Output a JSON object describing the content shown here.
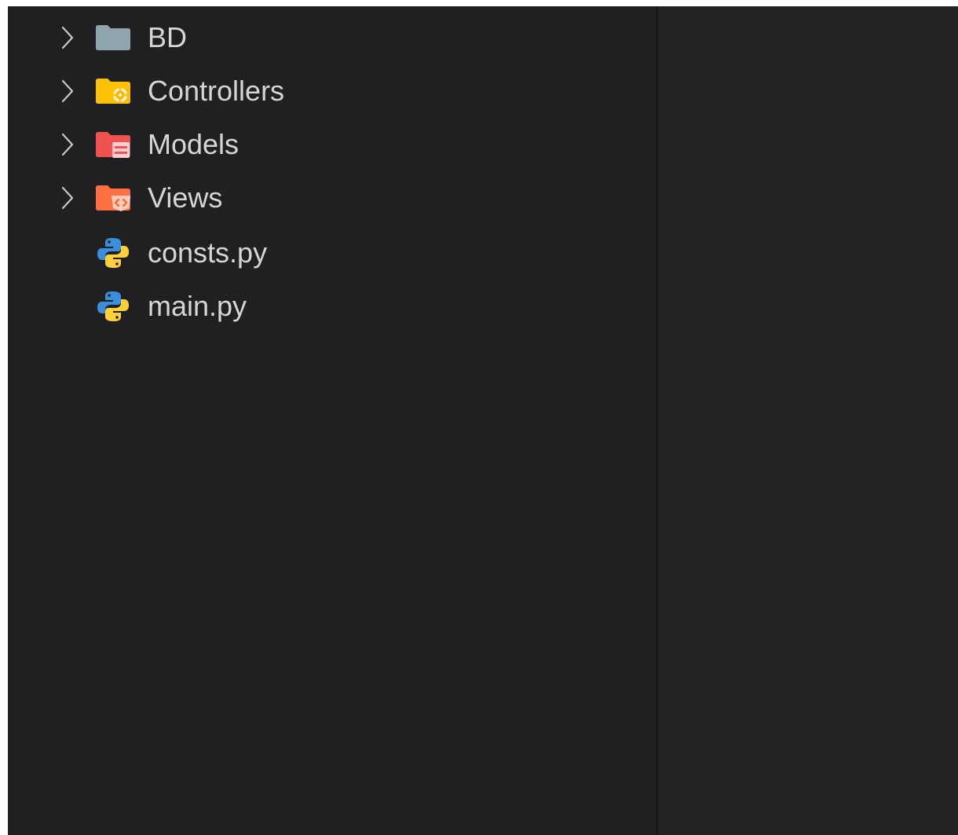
{
  "explorer": {
    "items": [
      {
        "label": "BD",
        "type": "folder",
        "icon": "folder-icon",
        "color": "#90a4ae",
        "expandable": true
      },
      {
        "label": "Controllers",
        "type": "folder",
        "icon": "folder-controllers-icon",
        "color": "#ffc107",
        "expandable": true
      },
      {
        "label": "Models",
        "type": "folder",
        "icon": "folder-models-icon",
        "color": "#ef5350",
        "expandable": true
      },
      {
        "label": "Views",
        "type": "folder",
        "icon": "folder-views-icon",
        "color": "#ff7043",
        "expandable": true
      },
      {
        "label": "consts.py",
        "type": "file",
        "icon": "python-icon",
        "expandable": false
      },
      {
        "label": "main.py",
        "type": "file",
        "icon": "python-icon",
        "expandable": false
      }
    ]
  },
  "colors": {
    "background": "#202022",
    "text": "#d6d6d8",
    "chevron": "#c8c8ca"
  }
}
